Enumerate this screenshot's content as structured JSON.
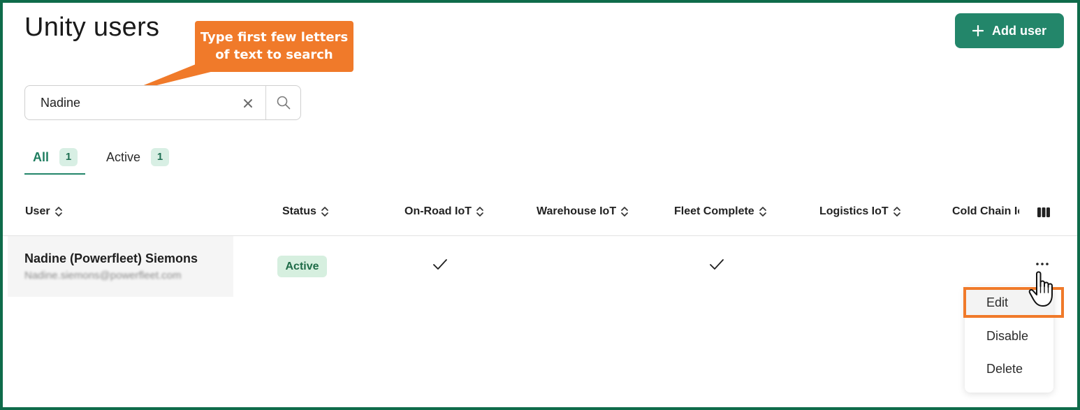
{
  "page": {
    "title": "Unity users"
  },
  "callout": {
    "lines": [
      "Type first few letters",
      "of text to search"
    ],
    "color": "#f07a2a"
  },
  "header": {
    "add_user_label": "Add user",
    "add_user_icon": "plus-icon"
  },
  "search": {
    "value": "Nadine",
    "clear_icon": "close-icon",
    "search_icon": "search-icon"
  },
  "tabs": [
    {
      "label": "All",
      "count": "1",
      "selected": true
    },
    {
      "label": "Active",
      "count": "1",
      "selected": false
    }
  ],
  "table": {
    "columns": [
      "User",
      "Status",
      "On-Road IoT",
      "Warehouse IoT",
      "Fleet Complete",
      "Logistics IoT",
      "Cold Chain IoT"
    ],
    "settings_icon": "columns-icon",
    "rows": [
      {
        "name": "Nadine (Powerfleet) Siemons",
        "email": "Nadine.siemons@powerfleet.com",
        "status": "Active",
        "on_road_iot": true,
        "warehouse_iot": false,
        "fleet_complete": true,
        "logistics_iot": false,
        "cold_chain_iot": false
      }
    ]
  },
  "row_menu": {
    "items": [
      "Edit",
      "Disable",
      "Delete"
    ],
    "highlighted": "Edit"
  },
  "colors": {
    "accent": "#23866a",
    "frame_border": "#0f6b4a",
    "status_active_bg": "#d6efdf",
    "highlight": "#f07a2a"
  }
}
